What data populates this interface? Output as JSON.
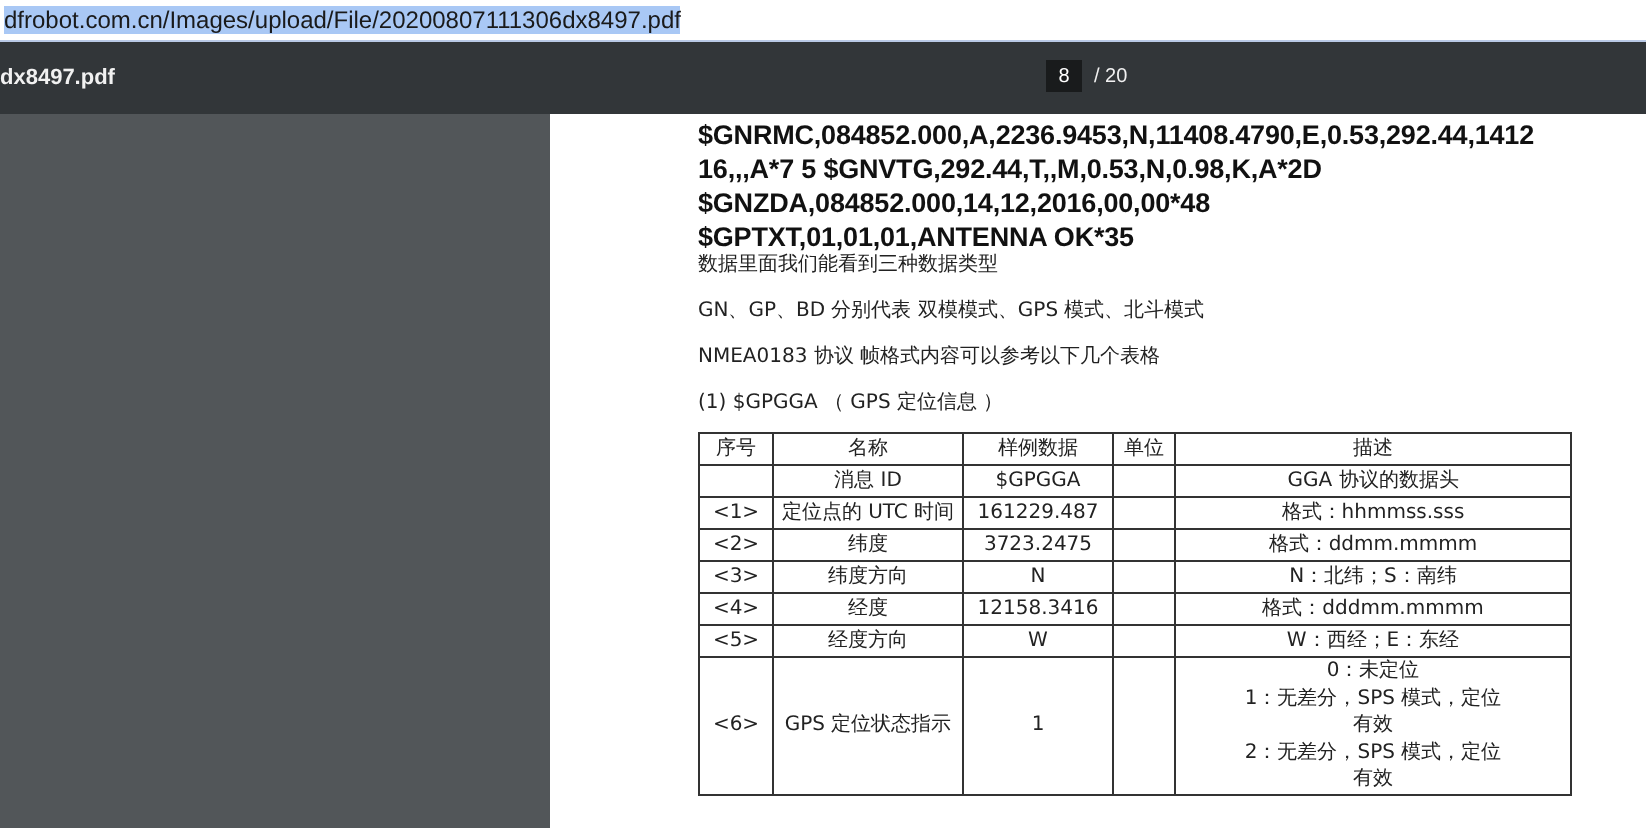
{
  "address_bar": {
    "url": "dfrobot.com.cn/Images/upload/File/20200807111306dx8497.pdf",
    "selected": true
  },
  "toolbar": {
    "title": "dx8497.pdf",
    "page_number": "8",
    "page_total": "/ 20"
  },
  "document": {
    "code_lines": [
      "$GNRMC,084852.000,A,2236.9453,N,11408.4790,E,0.53,292.44,1412",
      "16,,,A*7 5 $GNVTG,292.44,T,,M,0.53,N,0.98,K,A*2D",
      "$GNZDA,084852.000,14,12,2016,00,00*48",
      "$GPTXT,01,01,01,ANTENNA OK*35"
    ],
    "paragraphs": [
      "数据里面我们能看到三种数据类型",
      "GN、GP、BD 分别代表 双模模式、GPS 模式、北斗模式",
      "NMEA0183 协议 帧格式内容可以参考以下几个表格",
      "(1) $GPGGA （ GPS 定位信息 ）"
    ],
    "table": {
      "columns": [
        "序号",
        "名称",
        "样例数据",
        "单位",
        "描述"
      ],
      "rows": [
        {
          "cells": [
            "",
            "消息 ID",
            "$GPGGA",
            "",
            [
              "GGA 协议的数据头"
            ]
          ]
        },
        {
          "cells": [
            "<1>",
            "定位点的 UTC 时间",
            "161229.487",
            "",
            [
              "格式：hhmmss.sss"
            ]
          ]
        },
        {
          "cells": [
            "<2>",
            "纬度",
            "3723.2475",
            "",
            [
              "格式：ddmm.mmmm"
            ]
          ]
        },
        {
          "cells": [
            "<3>",
            "纬度方向",
            "N",
            "",
            [
              "N：北纬；S：南纬"
            ]
          ]
        },
        {
          "cells": [
            "<4>",
            "经度",
            "12158.3416",
            "",
            [
              "格式：dddmm.mmmm"
            ]
          ]
        },
        {
          "cells": [
            "<5>",
            "经度方向",
            "W",
            "",
            [
              "W：西经；E：东经"
            ]
          ]
        },
        {
          "cells": [
            "<6>",
            "GPS 定位状态指示",
            "1",
            "",
            [
              "0：未定位",
              "1：无差分，SPS 模式，定位",
              "有效",
              "2：无差分，SPS 模式，定位",
              "有效"
            ]
          ]
        }
      ]
    }
  }
}
